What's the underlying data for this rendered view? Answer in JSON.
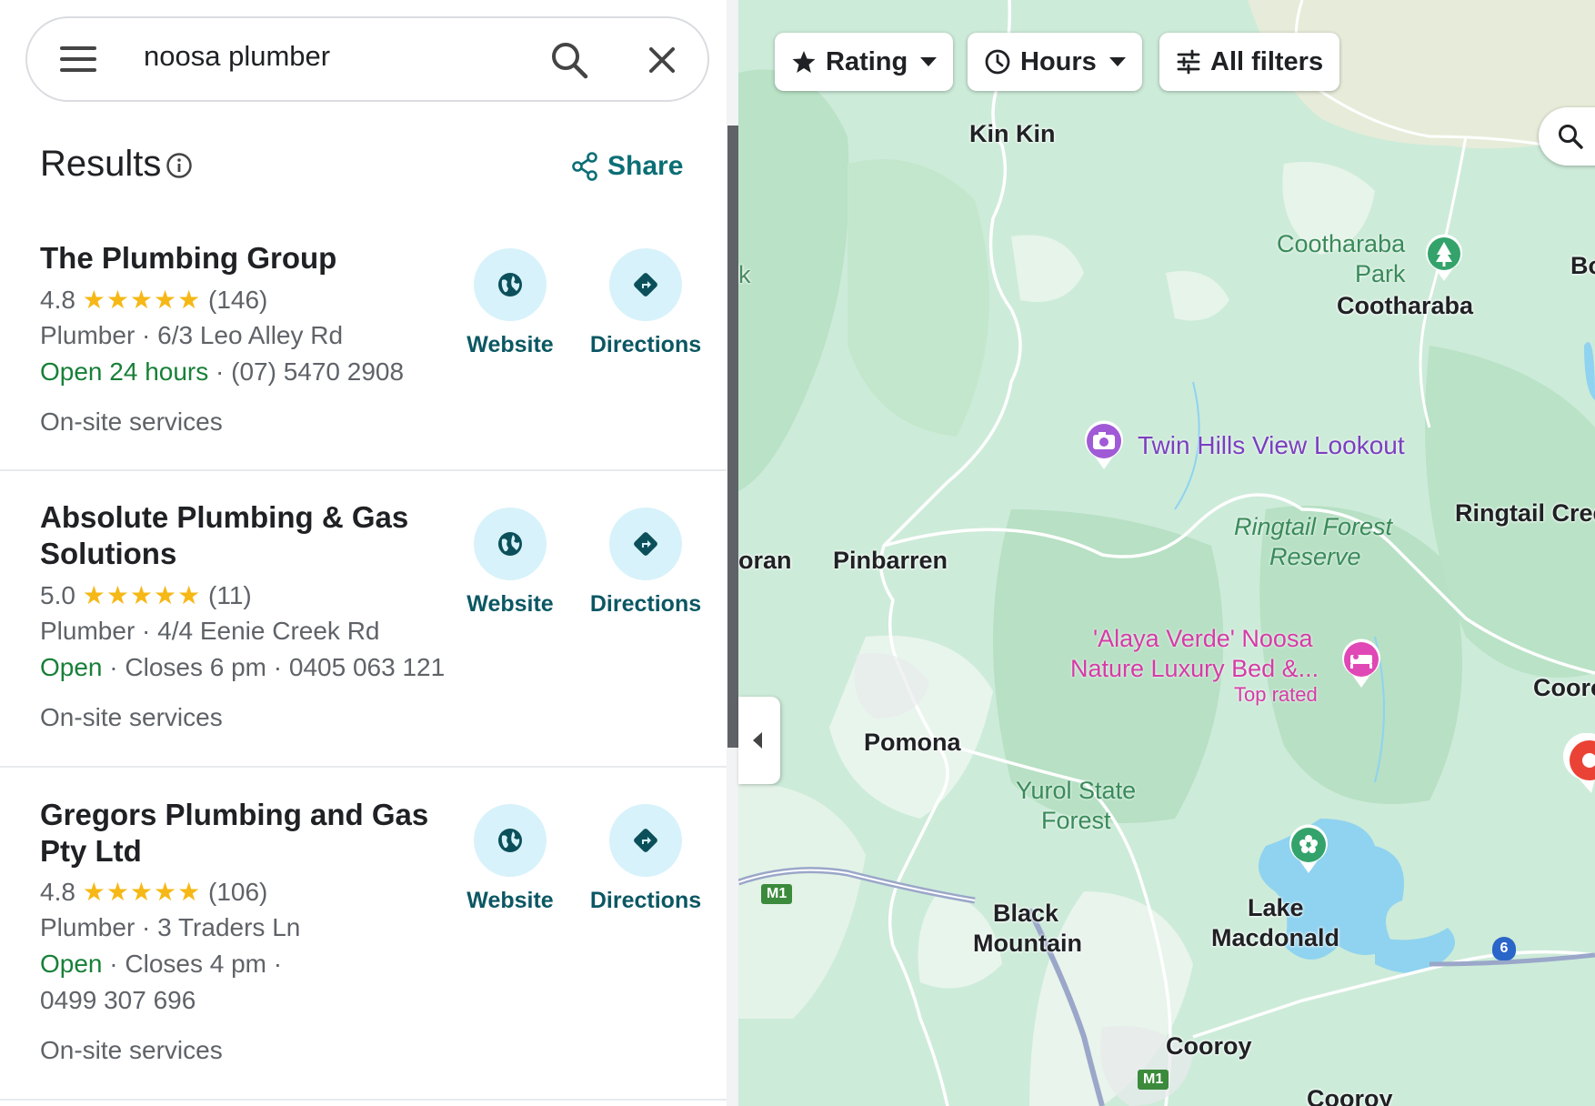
{
  "search": {
    "query": "noosa plumber"
  },
  "results_header": {
    "title": "Results",
    "share_label": "Share"
  },
  "results": [
    {
      "name": "The Plumbing Group",
      "rating": "4.8",
      "stars": "★★★★★",
      "reviews": "(146)",
      "category_address": "Plumber · 6/3 Leo Alley Rd",
      "status": "Open 24 hours",
      "status_rest": " · (07) 5470 2908",
      "status_rest2": "",
      "services": "On-site services",
      "website_label": "Website",
      "directions_label": "Directions"
    },
    {
      "name": "Absolute Plumbing & Gas Solutions",
      "rating": "5.0",
      "stars": "★★★★★",
      "reviews": "(11)",
      "category_address": "Plumber · 4/4 Eenie Creek Rd",
      "status": "Open",
      "status_rest": " · Closes 6 pm · 0405 063 121",
      "status_rest2": "",
      "services": "On-site services",
      "website_label": "Website",
      "directions_label": "Directions"
    },
    {
      "name": "Gregors Plumbing and Gas Pty Ltd",
      "rating": "4.8",
      "stars": "★★★★★",
      "reviews": "(106)",
      "category_address": "Plumber · 3 Traders Ln",
      "status": "Open",
      "status_rest": " · Closes 4 pm ·",
      "status_rest2": "0499 307 696",
      "services": "On-site services",
      "website_label": "Website",
      "directions_label": "Directions"
    }
  ],
  "map": {
    "filters": {
      "rating": "Rating",
      "hours": "Hours",
      "all_filters": "All filters"
    },
    "places": {
      "kin_kin": "Kin Kin",
      "cootharaba_park_1": "Cootharaba",
      "cootharaba_park_2": "Park",
      "cootharaba": "Cootharaba",
      "bo": "Bo",
      "twin_hills": "Twin Hills View Lookout",
      "ringtail_creek": "Ringtail Cree",
      "ringtail_forest_1": "Ringtail Forest",
      "ringtail_forest_2": "Reserve",
      "oran": "oran",
      "pinbarren": "Pinbarren",
      "alaya_1": "'Alaya Verde' Noosa",
      "alaya_2": "Nature Luxury Bed &...",
      "alaya_top": "Top rated",
      "cooro": "Cooro",
      "pomona": "Pomona",
      "yurol_1": "Yurol State",
      "yurol_2": "Forest",
      "black_mountain_1": "Black",
      "black_mountain_2": "Mountain",
      "lake_macdonald_1": "Lake",
      "lake_macdonald_2": "Macdonald",
      "cooroy": "Cooroy",
      "cooroy_bottom": "Cooroy",
      "k": "k"
    },
    "shields": {
      "m1_a": "M1",
      "m1_b": "M1",
      "route_6": "6"
    },
    "colors": {
      "land": "#cdebd9",
      "forest": "#b7e0c4",
      "water": "#8fd3f0",
      "road": "#ffffff",
      "highway": "#9aa7c9"
    }
  }
}
